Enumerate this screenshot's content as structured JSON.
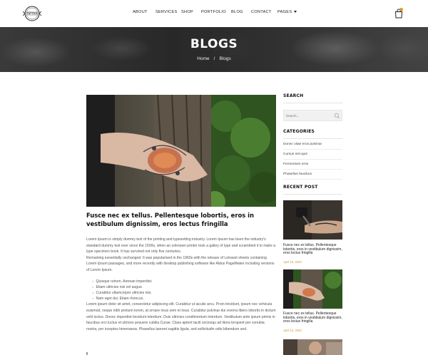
{
  "brand": {
    "logo_text": "TATTOO",
    "logo_icon": "brand-logo-icon"
  },
  "nav": {
    "items": [
      {
        "label": "ABOUT"
      },
      {
        "label": "SERVICES"
      },
      {
        "label": "SHOP"
      },
      {
        "label": "PORTFOLIO"
      },
      {
        "label": "BLOG"
      },
      {
        "label": "CONTACT"
      },
      {
        "label": "PAGES"
      }
    ],
    "cart_icon": "shopping-bag-icon",
    "cart_badge_color": "#d79c2c"
  },
  "banner": {
    "title": "BLOGS",
    "breadcrumb": {
      "home": "Home",
      "separator": "/",
      "current": "Blogs"
    }
  },
  "post": {
    "title": "Fusce nec ex tellus. Pellentesque lobortis, eros in vestibulum dignissim, eros lectus fringilla",
    "paragraph1": "Lorem Ipsum is simply dummy text of the printing and typesetting industry. Lorem Ipsum has been the industry's standard dummy text ever since the 1500s, when an unknown printer took a galley of type and scrambled it to make a type specimen book. It has survived not only five centuries.",
    "paragraph2": "Remaining essentially unchanged. It was popularised in the 1960s with the release of Letraset sheets containing Lorem Ipsum passages, and more recently with desktop publishing software like Aldus PageMaker including versions of Lorem Ipsum.",
    "list": [
      "Quisque rutrum. Aenean imperdiet.",
      "Etiam ultricies nisi vel augue.",
      "Curabitur ullamcorper ultricies nisi.",
      "Nam eget dui. Etiam rhoncus."
    ],
    "paragraph3": "Lorem ipsum dolor sit amet, consectetur adipiscing elit. Curabitur ut iaculis arcu. Proin tincidunt, ipsum nec vehicula euismod, neque nibh pretium lorem, at ornare risus sem et risus. Curabitur pulvinar dui viverra libero lobortis in dictum velit luctus. Donec imperdiet tincidunt interdum. Duis ultricies condimentum interdum. Vestibulum ante ipsum primis in faucibus orci luctus et ultrices posuere cubilia Curae; Class aptent taciti sociosqu ad litora torquent per conubia nostra, per inceptos himenaeos. Phasellus laoreet sagittis ligula, sed sollicitudin odio bibendum sed."
  },
  "sidebar": {
    "search": {
      "heading": "SEARCH",
      "placeholder": "Search..."
    },
    "categories": {
      "heading": "CATEGORIES",
      "items": [
        {
          "label": "Donec vitae eros pulvinar"
        },
        {
          "label": "Cursus nisl quis"
        },
        {
          "label": "Fermentum eros"
        },
        {
          "label": "Phasellus faucibus"
        }
      ]
    },
    "recent": {
      "heading": "RECENT POST",
      "posts": [
        {
          "title": "Fusce nec ex tellus. Pellentesque lobortis, eros in vestibulum dignissim, eros lectus fringilla",
          "date": "April 16, 2020"
        },
        {
          "title": "Fusce nec ex tellus. Pellentesque lobortis, eros in vestibulum dignissim, eros lectus fringilla",
          "date": "April 14, 2020"
        }
      ]
    }
  },
  "colors": {
    "accent": "#c99a33",
    "text_dark": "#111111"
  }
}
